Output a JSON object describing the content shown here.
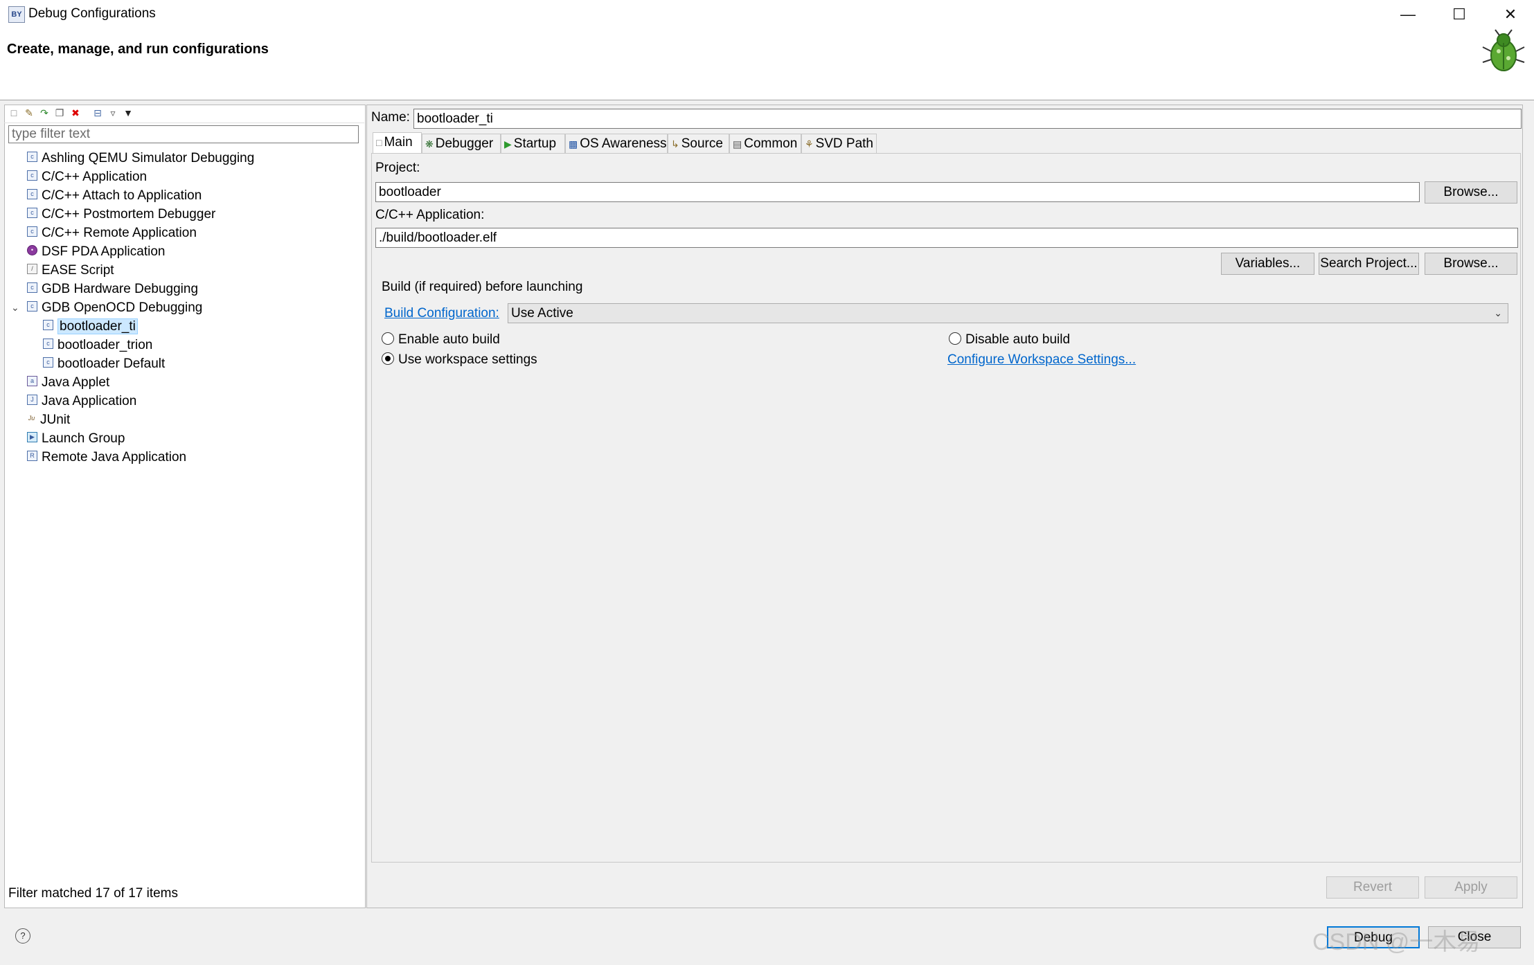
{
  "window": {
    "title": "Debug Configurations",
    "header": "Create, manage, and run configurations",
    "icon_name": "debug-config-icon",
    "controls": [
      "minimize-icon",
      "maximize-icon",
      "close-icon"
    ]
  },
  "left": {
    "toolbar_icons": [
      "new-config-icon",
      "new-prototype-icon",
      "export-icon",
      "duplicate-icon",
      "delete-icon",
      "collapse-all-icon",
      "filter-icon",
      "menu-dropdown-icon"
    ],
    "filter_placeholder": "type filter text",
    "tree": [
      {
        "label": "Ashling QEMU Simulator Debugging",
        "icon": "c-config-icon"
      },
      {
        "label": "C/C++ Application",
        "icon": "c-config-icon"
      },
      {
        "label": "C/C++ Attach to Application",
        "icon": "c-config-icon"
      },
      {
        "label": "C/C++ Postmortem Debugger",
        "icon": "c-config-icon"
      },
      {
        "label": "C/C++ Remote Application",
        "icon": "c-config-icon"
      },
      {
        "label": "DSF PDA Application",
        "icon": "pda-icon"
      },
      {
        "label": "EASE Script",
        "icon": "script-icon"
      },
      {
        "label": "GDB Hardware Debugging",
        "icon": "c-config-icon"
      },
      {
        "label": "GDB OpenOCD Debugging",
        "icon": "c-config-icon",
        "expanded": true
      },
      {
        "label": "bootloader_ti",
        "icon": "c-config-icon",
        "child": true,
        "selected": true
      },
      {
        "label": "bootloader_trion",
        "icon": "c-config-icon",
        "child": true
      },
      {
        "label": "bootloader Default",
        "icon": "c-config-icon",
        "child": true
      },
      {
        "label": "Java Applet",
        "icon": "java-applet-icon"
      },
      {
        "label": "Java Application",
        "icon": "java-app-icon"
      },
      {
        "label": "JUnit",
        "icon": "junit-icon"
      },
      {
        "label": "Launch Group",
        "icon": "launch-group-icon"
      },
      {
        "label": "Remote Java Application",
        "icon": "remote-java-icon"
      }
    ],
    "filter_status": "Filter matched 17 of 17 items"
  },
  "right": {
    "name_label": "Name:",
    "name_value": "bootloader_ti",
    "tabs": [
      {
        "label": "Main",
        "active": true,
        "icon": "main-tab-icon"
      },
      {
        "label": "Debugger",
        "icon": "debugger-tab-icon"
      },
      {
        "label": "Startup",
        "icon": "startup-tab-icon"
      },
      {
        "label": "OS Awareness",
        "icon": "os-awareness-tab-icon"
      },
      {
        "label": "Source",
        "icon": "source-tab-icon"
      },
      {
        "label": "Common",
        "icon": "common-tab-icon"
      },
      {
        "label": "SVD Path",
        "icon": "svd-path-tab-icon"
      }
    ],
    "project_label": "Project:",
    "project_value": "bootloader",
    "browse_label": "Browse...",
    "app_label": "C/C++ Application:",
    "app_value": "./build/bootloader.elf",
    "variables_label": "Variables...",
    "search_project_label": "Search Project...",
    "browse2_label": "Browse...",
    "build_group_title": "Build (if required) before launching",
    "build_config_link": "Build Configuration:",
    "build_config_value": "Use Active",
    "enable_auto_build": "Enable auto build",
    "disable_auto_build": "Disable auto build",
    "use_workspace_settings": "Use workspace settings",
    "configure_workspace_link": "Configure Workspace Settings...",
    "selected_build_option": "Use workspace settings",
    "revert_label": "Revert",
    "apply_label": "Apply"
  },
  "footer": {
    "debug_label": "Debug",
    "close_label": "Close",
    "watermark": "CSDN @一木易"
  }
}
